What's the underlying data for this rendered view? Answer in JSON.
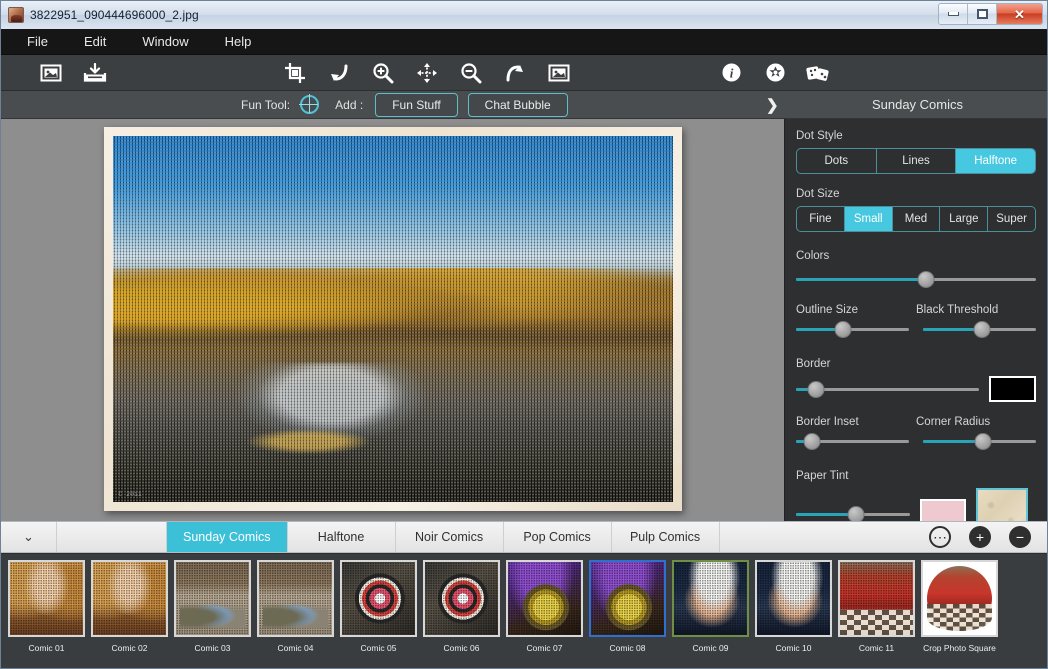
{
  "window": {
    "title": "3822951_090444696000_2.jpg",
    "icon": "photo-thumbnail-icon",
    "controls": {
      "minimize": "minimize-icon",
      "maximize": "maximize-icon",
      "close": "✕"
    }
  },
  "menubar": {
    "items": [
      {
        "label": "File"
      },
      {
        "label": "Edit"
      },
      {
        "label": "Window"
      },
      {
        "label": "Help"
      }
    ]
  },
  "toolbar": {
    "buttons": [
      {
        "name": "open-image-icon"
      },
      {
        "name": "save-image-icon"
      },
      {
        "name": "crop-icon"
      },
      {
        "name": "undo-icon"
      },
      {
        "name": "zoom-in-icon"
      },
      {
        "name": "move-icon"
      },
      {
        "name": "zoom-out-icon"
      },
      {
        "name": "redo-icon"
      },
      {
        "name": "fit-image-icon"
      },
      {
        "name": "info-icon"
      },
      {
        "name": "settings-icon"
      },
      {
        "name": "effects-icon"
      }
    ]
  },
  "subbar": {
    "fun_tool_label": "Fun Tool:",
    "fun_tool_icon": "target-ring-icon",
    "add_label": "Add :",
    "fun_stuff_button": "Fun Stuff",
    "chat_bubble_button": "Chat Bubble",
    "expand_icon": "chevron-right-icon",
    "panel_title": "Sunday Comics"
  },
  "canvas": {
    "photo_alt": "halftoned autumn lake landscape with paper border",
    "watermark": "C 2011"
  },
  "panel": {
    "dot_style": {
      "label": "Dot Style",
      "options": [
        "Dots",
        "Lines",
        "Halftone"
      ],
      "selected": "Halftone"
    },
    "dot_size": {
      "label": "Dot Size",
      "options": [
        "Fine",
        "Small",
        "Med",
        "Large",
        "Super"
      ],
      "selected": "Small"
    },
    "sliders": [
      {
        "label": "Colors",
        "value": 54
      },
      {
        "label": "Outline Size",
        "value": 42
      },
      {
        "label": "Black Threshold",
        "value": 52
      },
      {
        "label": "Border",
        "value": 11
      },
      {
        "label": "Border Inset",
        "value": 14
      },
      {
        "label": "Corner Radius",
        "value": 53
      },
      {
        "label": "Paper Tint",
        "value": 53
      }
    ],
    "border_color_swatch": "#000000",
    "paper_tint_swatch": "#efc9d0",
    "paper_texture_swatch": "#e2d5b8"
  },
  "tabbar": {
    "collapse_icon": "chevron-down-icon",
    "tabs": [
      {
        "label": "Sunday Comics",
        "active": true
      },
      {
        "label": "Halftone",
        "active": false
      },
      {
        "label": "Noir Comics",
        "active": false
      },
      {
        "label": "Pop Comics",
        "active": false
      },
      {
        "label": "Pulp Comics",
        "active": false
      }
    ],
    "actions": [
      {
        "name": "randomize-icon",
        "glyph": "⋯"
      },
      {
        "name": "add-preset-icon",
        "glyph": "+"
      },
      {
        "name": "remove-preset-icon",
        "glyph": "−"
      }
    ]
  },
  "filmstrip": {
    "items": [
      {
        "label": "Comic 01",
        "art": "art-woman",
        "selected": false
      },
      {
        "label": "Comic 02",
        "art": "art-woman",
        "selected": false
      },
      {
        "label": "Comic 03",
        "art": "art-cans",
        "selected": false
      },
      {
        "label": "Comic 04",
        "art": "art-cans",
        "selected": false
      },
      {
        "label": "Comic 05",
        "art": "art-star",
        "selected": false
      },
      {
        "label": "Comic 06",
        "art": "art-star",
        "selected": false
      },
      {
        "label": "Comic 07",
        "art": "art-clock",
        "selected": false
      },
      {
        "label": "Comic 08",
        "art": "art-clock",
        "selected": true
      },
      {
        "label": "Comic 09",
        "art": "art-man",
        "selected": true
      },
      {
        "label": "Comic 10",
        "art": "art-man",
        "selected": false
      },
      {
        "label": "Comic 11",
        "art": "art-red",
        "selected": false
      },
      {
        "label": "Crop Photo\nSquare",
        "art": "art-crop",
        "selected": false
      }
    ]
  },
  "colors": {
    "accent": "#3cc0d8",
    "slider_fill": "#29a3b8",
    "panel_bg": "#2d2f30",
    "toolbar_bg": "#3c3f41",
    "menubar_bg": "#161616"
  }
}
